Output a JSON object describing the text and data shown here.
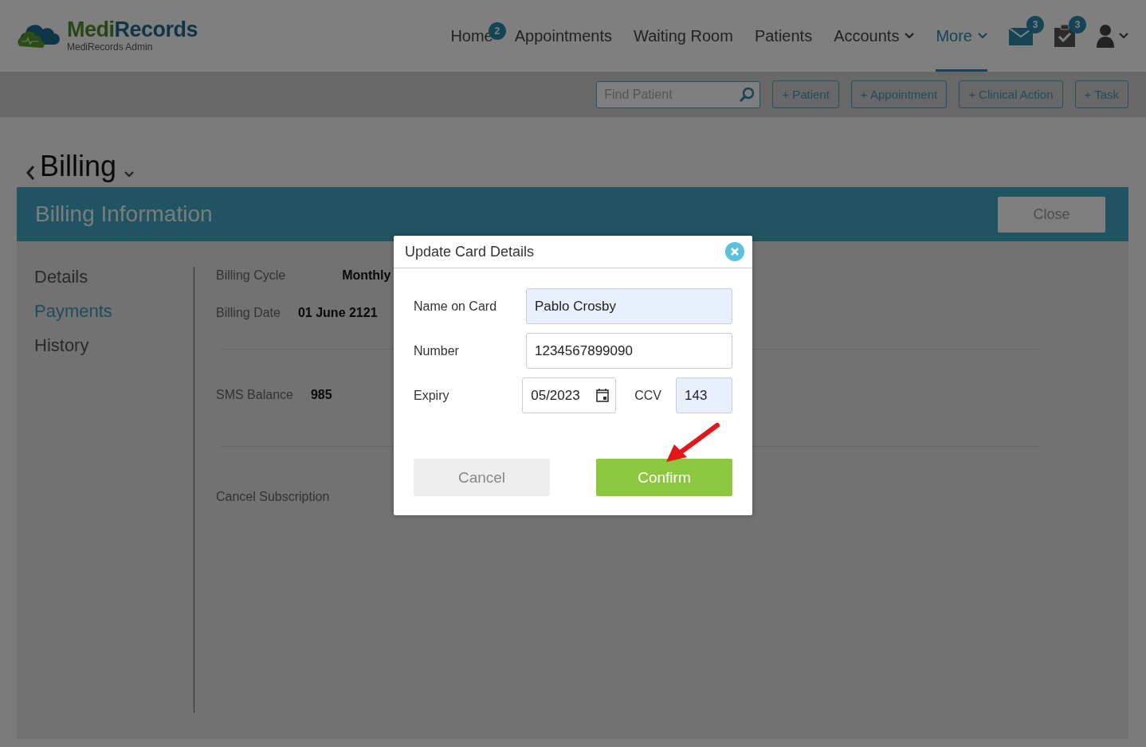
{
  "header": {
    "logo": {
      "name_first": "Medi",
      "name_second": "Records",
      "subtitle": "MediRecords Admin"
    },
    "nav": [
      {
        "label": "Home",
        "selected": false,
        "dropdown": false,
        "badge": "2"
      },
      {
        "label": "Appointments",
        "selected": false,
        "dropdown": false
      },
      {
        "label": "Waiting Room",
        "selected": false,
        "dropdown": false
      },
      {
        "label": "Patients",
        "selected": false,
        "dropdown": false
      },
      {
        "label": "Accounts",
        "selected": false,
        "dropdown": true
      },
      {
        "label": "More",
        "selected": true,
        "dropdown": true
      }
    ],
    "icons": [
      {
        "kind": "mail",
        "badge": "3"
      },
      {
        "kind": "tasks",
        "badge": "3"
      },
      {
        "kind": "user"
      }
    ]
  },
  "toolbar": {
    "search": {
      "placeholder": "Find Patient"
    },
    "buttons": [
      "+ Patient",
      "+ Appointment",
      "+ Clinical Action",
      "+ Task"
    ]
  },
  "page_title": "Billing",
  "panel": {
    "title": "Billing Information",
    "close_button": "Close",
    "sidebar": [
      {
        "label": "Details",
        "selected": false
      },
      {
        "label": "Payments",
        "selected": true
      },
      {
        "label": "History",
        "selected": false
      }
    ],
    "fields": [
      {
        "label": "Billing Cycle",
        "value": "Monthly"
      },
      {
        "label": "Billing Date",
        "value": "01 June 2121"
      },
      {
        "label": "SMS Balance",
        "value": "985"
      },
      {
        "label": "Cancel Subscription"
      }
    ]
  },
  "modal": {
    "title": "Update Card Details",
    "fields": [
      {
        "label": "Name on Card",
        "value": "Pablo Crosby",
        "highlighted": true
      },
      {
        "label": "Number",
        "value": "1234567899090",
        "highlighted": false
      }
    ],
    "expiry": {
      "label": "Expiry",
      "value": "05/2023"
    },
    "ccv": {
      "label": "CCV",
      "value": "143",
      "highlighted": true
    },
    "buttons": [
      {
        "label": "Cancel",
        "kind": "secondary"
      },
      {
        "label": "Confirm",
        "kind": "primary"
      }
    ]
  }
}
